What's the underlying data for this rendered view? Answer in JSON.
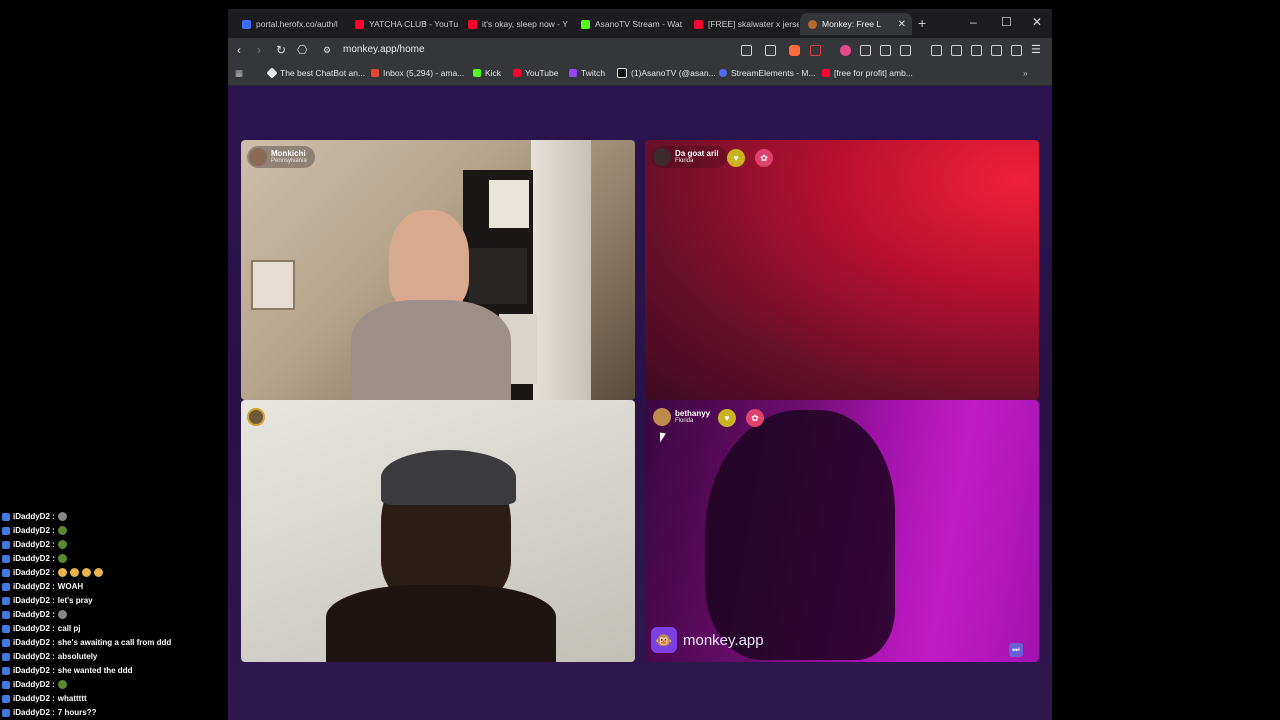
{
  "browser": {
    "tabs": [
      {
        "title": "portal.herofx.co/auth/l",
        "icon": "globe-icon"
      },
      {
        "title": "YATCHA CLUB - YouTu",
        "icon": "youtube-icon"
      },
      {
        "title": "it's okay, sleep now - Y",
        "icon": "youtube-icon"
      },
      {
        "title": "AsanoTV Stream - Wat",
        "icon": "kick-icon"
      },
      {
        "title": "[FREE] skaiwater x jerse",
        "icon": "youtube-icon"
      },
      {
        "title": "Monkey: Free L",
        "icon": "monkey-icon",
        "active": true
      }
    ],
    "url": "monkey.app/home",
    "bookmarks": [
      {
        "label": "The best ChatBot an...",
        "icon": "chatbot-icon"
      },
      {
        "label": "Inbox (5,294) - ama...",
        "icon": "gmail-icon"
      },
      {
        "label": "Kick",
        "icon": "kick-icon"
      },
      {
        "label": "YouTube",
        "icon": "youtube-icon"
      },
      {
        "label": "Twitch",
        "icon": "twitch-icon"
      },
      {
        "label": "(1)AsanoTV (@asan...",
        "icon": "tiktok-icon"
      },
      {
        "label": "StreamElements - M...",
        "icon": "streamelements-icon"
      },
      {
        "label": "[free for profit] amb...",
        "icon": "youtube-icon"
      }
    ]
  },
  "video_tiles": [
    {
      "name": "Monkichi",
      "location": "Pennsylvania"
    },
    {
      "name": "Da goat aril",
      "location": "Florida"
    },
    {
      "name": "",
      "location": ""
    },
    {
      "name": "bethanyy",
      "location": "Florida"
    }
  ],
  "brand": {
    "text": "monkey.app"
  },
  "chat": [
    {
      "user": "iDaddyD2 :",
      "text": "",
      "emotes": [
        "plant"
      ]
    },
    {
      "user": "iDaddyD2 :",
      "text": "",
      "emotes": [
        "rose"
      ]
    },
    {
      "user": "iDaddyD2 :",
      "text": "",
      "emotes": [
        "rose"
      ]
    },
    {
      "user": "iDaddyD2 :",
      "text": "",
      "emotes": [
        "rose"
      ]
    },
    {
      "user": "iDaddyD2 :",
      "text": "",
      "emotes": [
        "face",
        "face",
        "face",
        "face"
      ]
    },
    {
      "user": "iDaddyD2 :",
      "text": "WOAH",
      "emotes": []
    },
    {
      "user": "iDaddyD2 :",
      "text": "let's pray",
      "emotes": []
    },
    {
      "user": "iDaddyD2 :",
      "text": "",
      "emotes": [
        "plant"
      ]
    },
    {
      "user": "iDaddyD2 :",
      "text": "call pj",
      "emotes": []
    },
    {
      "user": "iDaddyD2 :",
      "text": "she's awaiting a call from ddd",
      "emotes": []
    },
    {
      "user": "iDaddyD2 :",
      "text": "absolutely",
      "emotes": []
    },
    {
      "user": "iDaddyD2 :",
      "text": "she wanted the ddd",
      "emotes": []
    },
    {
      "user": "iDaddyD2 :",
      "text": "",
      "emotes": [
        "rose"
      ]
    },
    {
      "user": "iDaddyD2 :",
      "text": "whattttt",
      "emotes": []
    },
    {
      "user": "iDaddyD2 :",
      "text": "7 hours??",
      "emotes": []
    }
  ]
}
